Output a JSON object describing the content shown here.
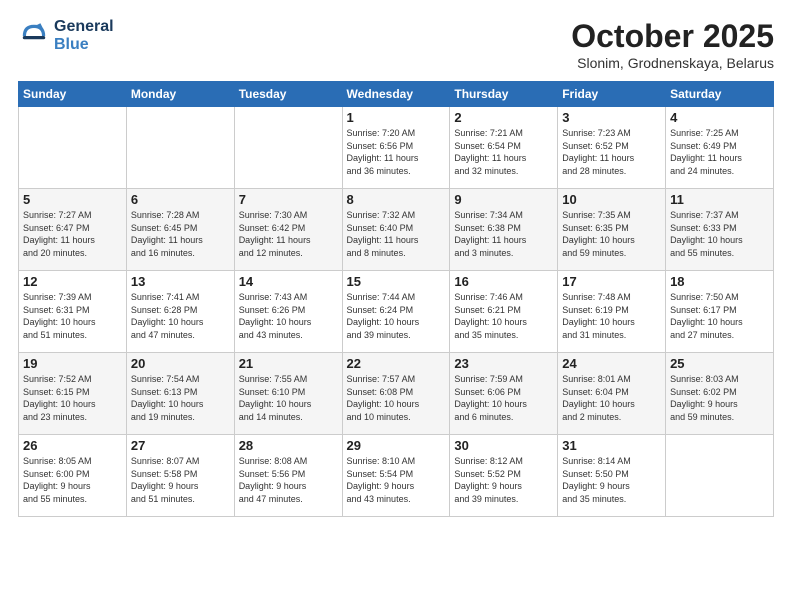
{
  "logo": {
    "line1": "General",
    "line2": "Blue"
  },
  "title": "October 2025",
  "location": "Slonim, Grodnenskaya, Belarus",
  "headers": [
    "Sunday",
    "Monday",
    "Tuesday",
    "Wednesday",
    "Thursday",
    "Friday",
    "Saturday"
  ],
  "weeks": [
    {
      "shaded": false,
      "days": [
        {
          "num": "",
          "info": ""
        },
        {
          "num": "",
          "info": ""
        },
        {
          "num": "",
          "info": ""
        },
        {
          "num": "1",
          "info": "Sunrise: 7:20 AM\nSunset: 6:56 PM\nDaylight: 11 hours\nand 36 minutes."
        },
        {
          "num": "2",
          "info": "Sunrise: 7:21 AM\nSunset: 6:54 PM\nDaylight: 11 hours\nand 32 minutes."
        },
        {
          "num": "3",
          "info": "Sunrise: 7:23 AM\nSunset: 6:52 PM\nDaylight: 11 hours\nand 28 minutes."
        },
        {
          "num": "4",
          "info": "Sunrise: 7:25 AM\nSunset: 6:49 PM\nDaylight: 11 hours\nand 24 minutes."
        }
      ]
    },
    {
      "shaded": true,
      "days": [
        {
          "num": "5",
          "info": "Sunrise: 7:27 AM\nSunset: 6:47 PM\nDaylight: 11 hours\nand 20 minutes."
        },
        {
          "num": "6",
          "info": "Sunrise: 7:28 AM\nSunset: 6:45 PM\nDaylight: 11 hours\nand 16 minutes."
        },
        {
          "num": "7",
          "info": "Sunrise: 7:30 AM\nSunset: 6:42 PM\nDaylight: 11 hours\nand 12 minutes."
        },
        {
          "num": "8",
          "info": "Sunrise: 7:32 AM\nSunset: 6:40 PM\nDaylight: 11 hours\nand 8 minutes."
        },
        {
          "num": "9",
          "info": "Sunrise: 7:34 AM\nSunset: 6:38 PM\nDaylight: 11 hours\nand 3 minutes."
        },
        {
          "num": "10",
          "info": "Sunrise: 7:35 AM\nSunset: 6:35 PM\nDaylight: 10 hours\nand 59 minutes."
        },
        {
          "num": "11",
          "info": "Sunrise: 7:37 AM\nSunset: 6:33 PM\nDaylight: 10 hours\nand 55 minutes."
        }
      ]
    },
    {
      "shaded": false,
      "days": [
        {
          "num": "12",
          "info": "Sunrise: 7:39 AM\nSunset: 6:31 PM\nDaylight: 10 hours\nand 51 minutes."
        },
        {
          "num": "13",
          "info": "Sunrise: 7:41 AM\nSunset: 6:28 PM\nDaylight: 10 hours\nand 47 minutes."
        },
        {
          "num": "14",
          "info": "Sunrise: 7:43 AM\nSunset: 6:26 PM\nDaylight: 10 hours\nand 43 minutes."
        },
        {
          "num": "15",
          "info": "Sunrise: 7:44 AM\nSunset: 6:24 PM\nDaylight: 10 hours\nand 39 minutes."
        },
        {
          "num": "16",
          "info": "Sunrise: 7:46 AM\nSunset: 6:21 PM\nDaylight: 10 hours\nand 35 minutes."
        },
        {
          "num": "17",
          "info": "Sunrise: 7:48 AM\nSunset: 6:19 PM\nDaylight: 10 hours\nand 31 minutes."
        },
        {
          "num": "18",
          "info": "Sunrise: 7:50 AM\nSunset: 6:17 PM\nDaylight: 10 hours\nand 27 minutes."
        }
      ]
    },
    {
      "shaded": true,
      "days": [
        {
          "num": "19",
          "info": "Sunrise: 7:52 AM\nSunset: 6:15 PM\nDaylight: 10 hours\nand 23 minutes."
        },
        {
          "num": "20",
          "info": "Sunrise: 7:54 AM\nSunset: 6:13 PM\nDaylight: 10 hours\nand 19 minutes."
        },
        {
          "num": "21",
          "info": "Sunrise: 7:55 AM\nSunset: 6:10 PM\nDaylight: 10 hours\nand 14 minutes."
        },
        {
          "num": "22",
          "info": "Sunrise: 7:57 AM\nSunset: 6:08 PM\nDaylight: 10 hours\nand 10 minutes."
        },
        {
          "num": "23",
          "info": "Sunrise: 7:59 AM\nSunset: 6:06 PM\nDaylight: 10 hours\nand 6 minutes."
        },
        {
          "num": "24",
          "info": "Sunrise: 8:01 AM\nSunset: 6:04 PM\nDaylight: 10 hours\nand 2 minutes."
        },
        {
          "num": "25",
          "info": "Sunrise: 8:03 AM\nSunset: 6:02 PM\nDaylight: 9 hours\nand 59 minutes."
        }
      ]
    },
    {
      "shaded": false,
      "days": [
        {
          "num": "26",
          "info": "Sunrise: 8:05 AM\nSunset: 6:00 PM\nDaylight: 9 hours\nand 55 minutes."
        },
        {
          "num": "27",
          "info": "Sunrise: 8:07 AM\nSunset: 5:58 PM\nDaylight: 9 hours\nand 51 minutes."
        },
        {
          "num": "28",
          "info": "Sunrise: 8:08 AM\nSunset: 5:56 PM\nDaylight: 9 hours\nand 47 minutes."
        },
        {
          "num": "29",
          "info": "Sunrise: 8:10 AM\nSunset: 5:54 PM\nDaylight: 9 hours\nand 43 minutes."
        },
        {
          "num": "30",
          "info": "Sunrise: 8:12 AM\nSunset: 5:52 PM\nDaylight: 9 hours\nand 39 minutes."
        },
        {
          "num": "31",
          "info": "Sunrise: 8:14 AM\nSunset: 5:50 PM\nDaylight: 9 hours\nand 35 minutes."
        },
        {
          "num": "",
          "info": ""
        }
      ]
    }
  ]
}
